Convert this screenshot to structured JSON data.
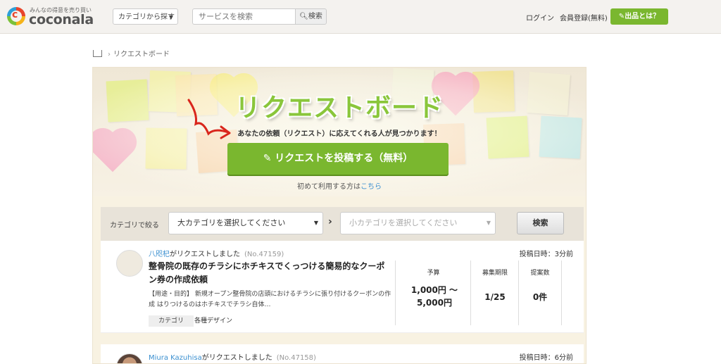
{
  "header": {
    "logo_tagline": "みんなの得意を売り買い",
    "logo_text": "coconala",
    "category_button": "カテゴリから探す",
    "search_placeholder": "サービスを検索",
    "search_button": "検索",
    "login": "ログイン",
    "register": "会員登録(無料)",
    "post_button": "出品とは？"
  },
  "breadcrumb": {
    "current": "リクエストボード"
  },
  "hero": {
    "title": "リクエストボード",
    "subtitle": "あなたの依頼（リクエスト）に応えてくれる人が見つかります！",
    "cta": "リクエストを投稿する（無料）",
    "first_time_text": "初めて利用する方は",
    "first_time_link": "こちら"
  },
  "filter": {
    "label": "カテゴリで絞る",
    "major_placeholder": "大カテゴリを選択してください",
    "minor_placeholder": "小カテゴリを選択してください",
    "search_button": "検索"
  },
  "requests": [
    {
      "user": "八咫杞",
      "requested_text": "がリクエストしました",
      "number": "(No.47159)",
      "posted": "投稿日時：3分前",
      "title": "整骨院の既存のチラシにホチキスでくっつける簡易的なクーポン券の作成依頼",
      "description": "【用途・目的】 新規オープン整骨院の店頭におけるチラシに張り付けるクーポンの作成 はりつけるのはホチキスでチラシ自体…",
      "category_label": "カテゴリ",
      "category_value": "各種デザイン",
      "budget_label": "予算",
      "budget_value": "1,000円 ～ 5,000円",
      "deadline_label": "募集期限",
      "deadline_value": "1/25",
      "proposals_label": "提案数",
      "proposals_value": "0件"
    },
    {
      "user": "Miura Kazuhisa",
      "requested_text": "がリクエストしました",
      "number": "(No.47158)",
      "posted": "投稿日時：6分前"
    }
  ],
  "colors": {
    "brand_green": "#7ab72f",
    "link_blue": "#3a8fd0"
  }
}
